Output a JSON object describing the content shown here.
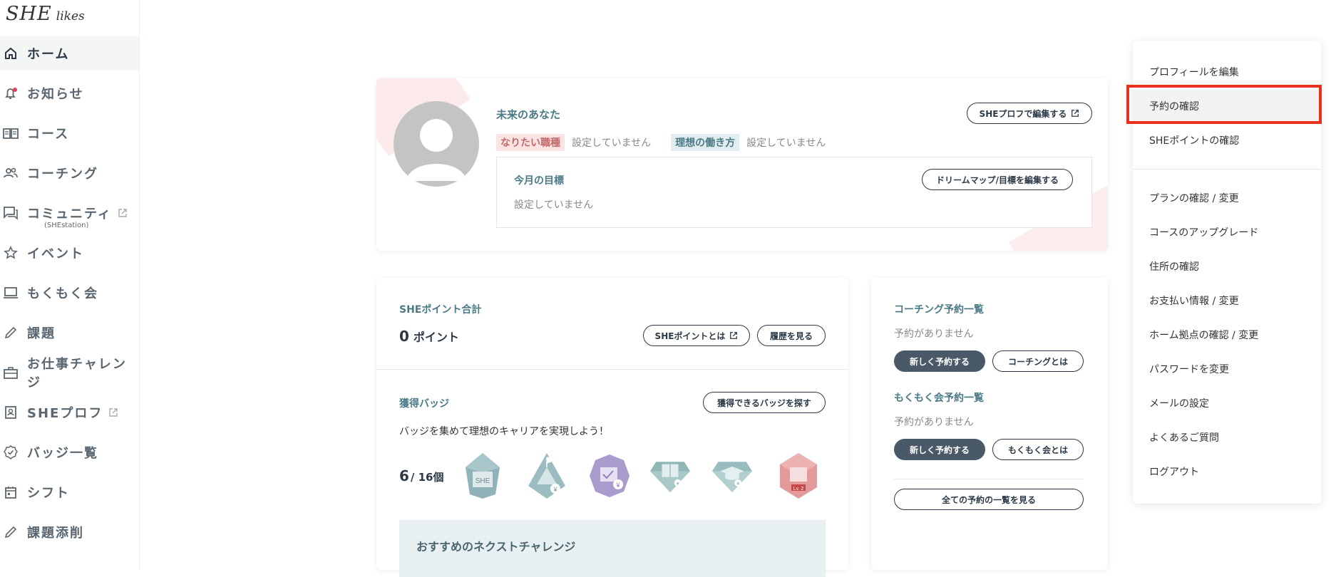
{
  "brand": {
    "logo_she": "SHE",
    "logo_likes": "likes"
  },
  "sidebar": {
    "items": [
      {
        "label": "ホーム",
        "icon": "home-icon",
        "active": true
      },
      {
        "label": "お知らせ",
        "icon": "bell-icon"
      },
      {
        "label": "コース",
        "icon": "book-icon"
      },
      {
        "label": "コーチング",
        "icon": "people-icon"
      },
      {
        "label": "コミュニティ",
        "icon": "chat-icon",
        "sub": "(SHEstation)"
      },
      {
        "label": "イベント",
        "icon": "star-icon"
      },
      {
        "label": "もくもく会",
        "icon": "laptop-icon"
      },
      {
        "label": "課題",
        "icon": "pencil-icon"
      },
      {
        "label": "お仕事チャレンジ",
        "icon": "briefcase-icon"
      },
      {
        "label": "SHEプロフ",
        "icon": "profile-card-icon"
      },
      {
        "label": "バッジ一覧",
        "icon": "badge-icon"
      },
      {
        "label": "シフト",
        "icon": "calendar-icon"
      },
      {
        "label": "課題添削",
        "icon": "pencil-icon"
      }
    ],
    "colors": {
      "notification_dot": "#e0405a"
    }
  },
  "profile": {
    "title": "未来のあなた",
    "edit_button": "SHEプロフで編集する",
    "tag1_label": "なりたい職種",
    "tag1_value": "設定していません",
    "tag2_label": "理想の働き方",
    "tag2_value": "設定していません",
    "goal_title": "今月の目標",
    "goal_button": "ドリームマップ/目標を編集する",
    "goal_value": "設定していません"
  },
  "points": {
    "title": "SHEポイント合計",
    "value": "0",
    "unit": "ポイント",
    "about_button": "SHEポイントとは",
    "history_button": "履歴を見る",
    "badges_title": "獲得バッジ",
    "badges_button": "獲得できるバッジを探す",
    "badges_text": "バッジを集めて理想のキャリアを実現しよう！",
    "badges_count": "6",
    "badges_total": "/ 16個",
    "badge_sample_text": "SHE",
    "badge_level_text": "Lv. 2",
    "next_title": "おすすめのネクストチャレンジ"
  },
  "booking": {
    "coaching_title": "コーチング予約一覧",
    "coaching_empty": "予約がありません",
    "coaching_new": "新しく予約する",
    "coaching_about": "コーチングとは",
    "mokumoku_title": "もくもく会予約一覧",
    "mokumoku_empty": "予約がありません",
    "mokumoku_new": "新しく予約する",
    "mokumoku_about": "もくもく会とは",
    "all_button": "全ての予約の一覧を見る"
  },
  "menu": {
    "items": [
      "プロフィールを編集",
      "予約の確認",
      "SHEポイントの確認",
      "プランの確認 / 変更",
      "コースのアップグレード",
      "住所の確認",
      "お支払い情報 / 変更",
      "ホーム拠点の確認 / 変更",
      "パスワードを変更",
      "メールの設定",
      "よくあるご質問",
      "ログアウト"
    ],
    "highlighted_index": 1,
    "highlight_color": "#e8311f"
  }
}
